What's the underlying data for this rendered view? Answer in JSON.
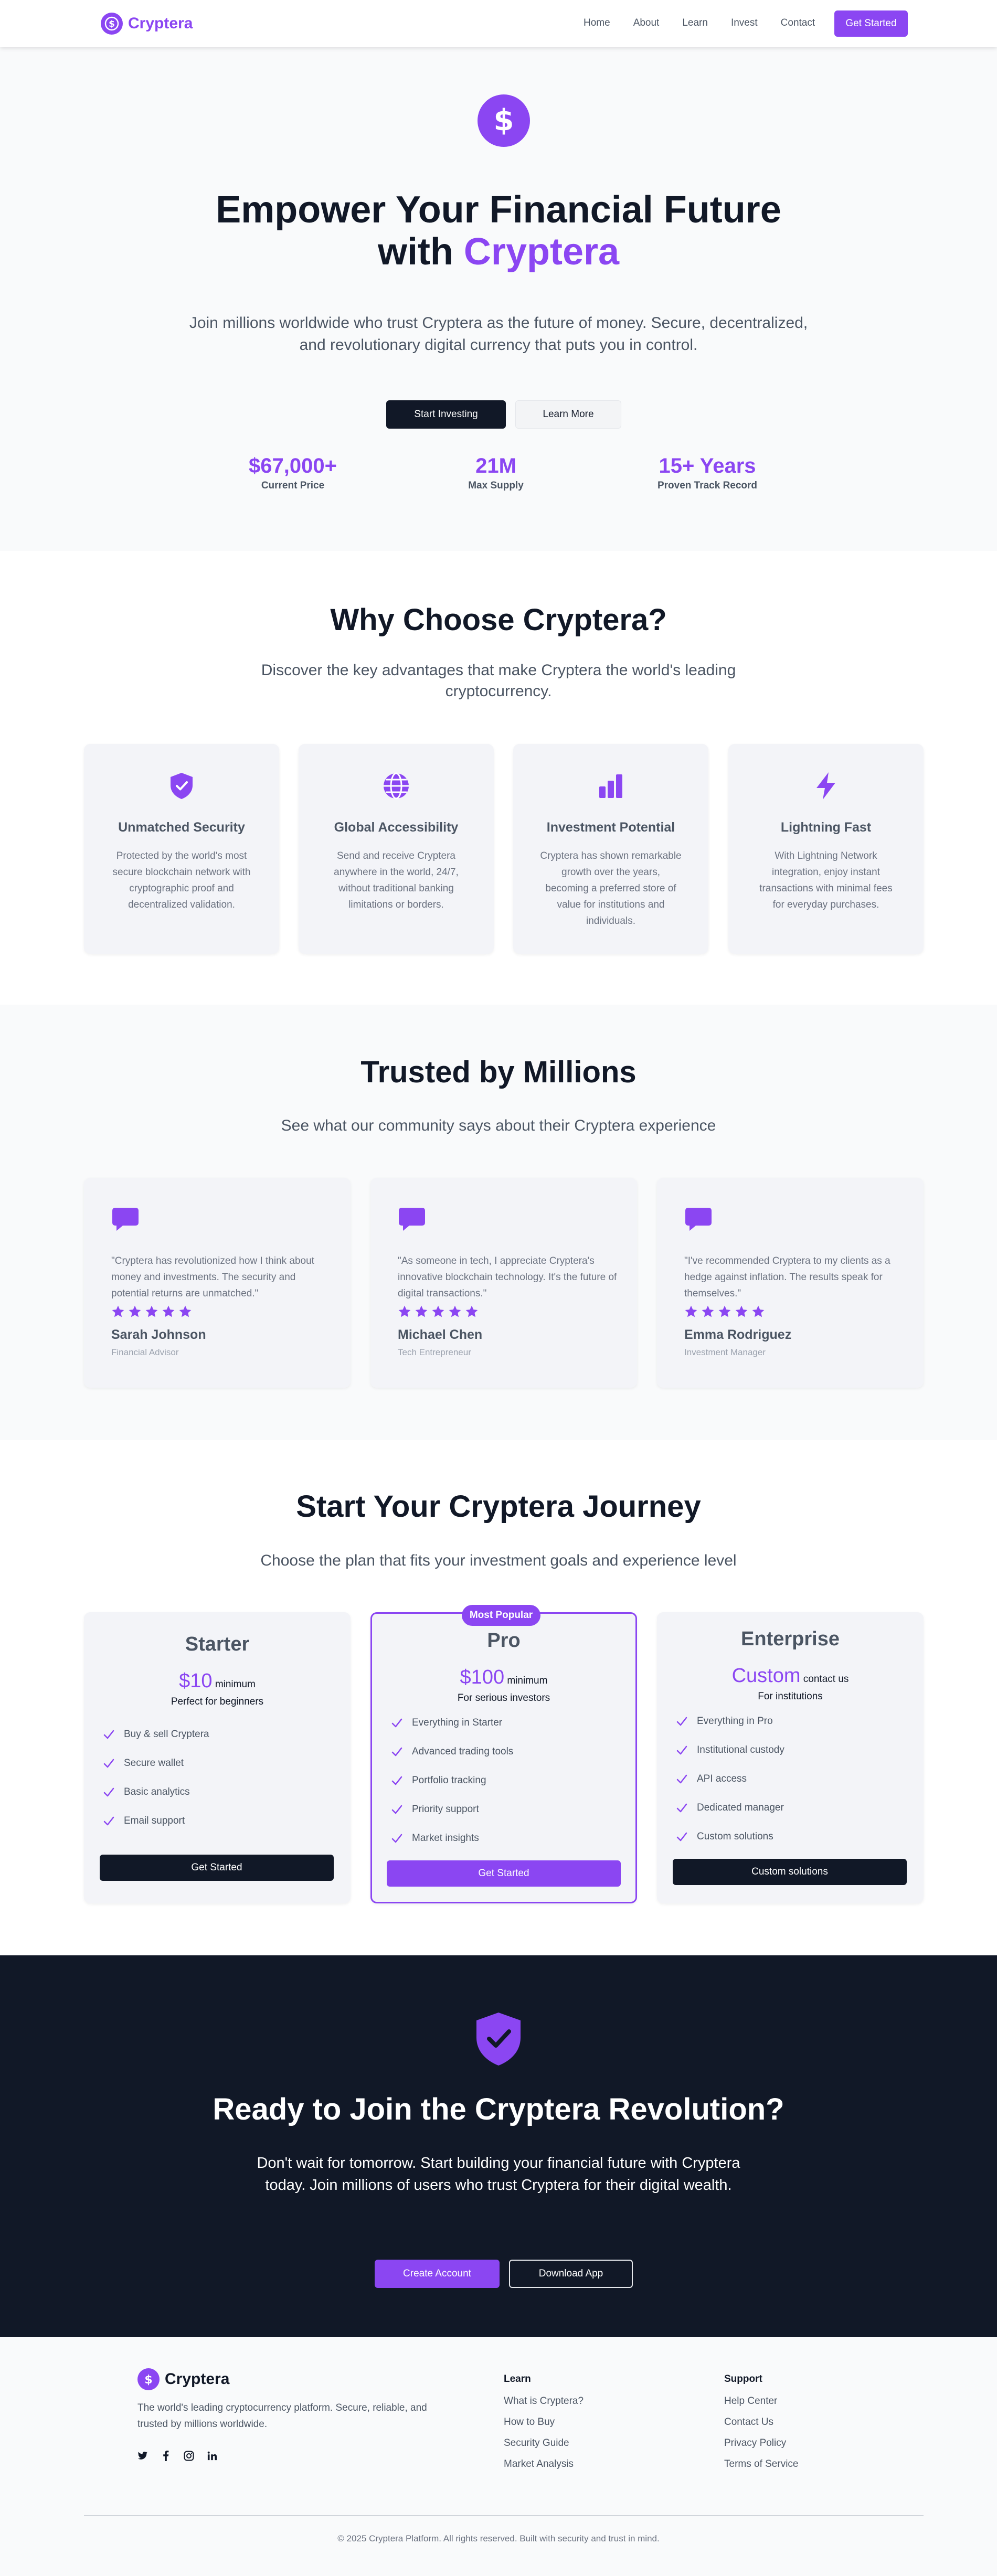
{
  "nav": {
    "brand": "Cryptera",
    "links": [
      "Home",
      "About",
      "Learn",
      "Invest",
      "Contact"
    ],
    "cta": "Get Started"
  },
  "hero": {
    "title_line1": "Empower Your Financial Future",
    "title_with": "with",
    "title_accent": "Cryptera",
    "subtitle": "Join millions worldwide who trust Cryptera as the future of money. Secure, decentralized, and revolutionary digital currency that puts you in control.",
    "primary_button": "Start Investing",
    "secondary_button": "Learn More",
    "stats": [
      {
        "value": "$67,000+",
        "label": "Current Price"
      },
      {
        "value": "21M",
        "label": "Max Supply"
      },
      {
        "value": "15+ Years",
        "label": "Proven Track Record"
      }
    ]
  },
  "features": {
    "title": "Why Choose Cryptera?",
    "subtitle": "Discover the key advantages that make Cryptera the world's leading cryptocurrency.",
    "items": [
      {
        "icon": "shield-check-icon",
        "title": "Unmatched Security",
        "desc": "Protected by the world's most secure blockchain network with cryptographic proof and decentralized validation."
      },
      {
        "icon": "globe-icon",
        "title": "Global Accessibility",
        "desc": "Send and receive Cryptera anywhere in the world, 24/7, without traditional banking limitations or borders."
      },
      {
        "icon": "bar-chart-icon",
        "title": "Investment Potential",
        "desc": "Cryptera has shown remarkable growth over the years, becoming a preferred store of value for institutions and individuals."
      },
      {
        "icon": "lightning-icon",
        "title": "Lightning Fast",
        "desc": "With Lightning Network integration, enjoy instant transactions with minimal fees for everyday purchases."
      }
    ]
  },
  "testimonials": {
    "title": "Trusted by Millions",
    "subtitle": "See what our community says about their Cryptera experience",
    "items": [
      {
        "text": "\"Cryptera has revolutionized how I think about money and investments. The security and potential returns are unmatched.\"",
        "name": "Sarah Johnson",
        "role": "Financial Advisor",
        "rating": 5
      },
      {
        "text": "\"As someone in tech, I appreciate Cryptera's innovative blockchain technology. It's the future of digital transactions.\"",
        "name": "Michael Chen",
        "role": "Tech Entrepreneur",
        "rating": 5
      },
      {
        "text": "\"I've recommended Cryptera to my clients as a hedge against inflation. The results speak for themselves.\"",
        "name": "Emma Rodriguez",
        "role": "Investment Manager",
        "rating": 5
      }
    ]
  },
  "pricing": {
    "title": "Start Your Cryptera Journey",
    "subtitle": "Choose the plan that fits your investment goals and experience level",
    "badge": "Most Popular",
    "plans": [
      {
        "name": "Starter",
        "price": "$10",
        "price_suffix": "minimum",
        "desc": "Perfect for beginners",
        "features": [
          "Buy & sell Cryptera",
          "Secure wallet",
          "Basic analytics",
          "Email support"
        ],
        "button": "Get Started"
      },
      {
        "name": "Pro",
        "price": "$100",
        "price_suffix": "minimum",
        "desc": "For serious investors",
        "features": [
          "Everything in Starter",
          "Advanced trading tools",
          "Portfolio tracking",
          "Priority support",
          "Market insights"
        ],
        "button": "Get Started"
      },
      {
        "name": "Enterprise",
        "price": "Custom",
        "price_suffix": "contact us",
        "desc": "For institutions",
        "features": [
          "Everything in Pro",
          "Institutional custody",
          "API access",
          "Dedicated manager",
          "Custom solutions"
        ],
        "button": "Custom solutions"
      }
    ]
  },
  "cta": {
    "title": "Ready to Join the Cryptera Revolution?",
    "subtitle": "Don't wait for tomorrow. Start building your financial future with Cryptera today. Join millions of users who trust Cryptera for their digital wealth.",
    "primary": "Create Account",
    "secondary": "Download App"
  },
  "footer": {
    "brand": "Cryptera",
    "desc": "The world's leading cryptocurrency platform. Secure, reliable, and trusted by millions worldwide.",
    "social": [
      "twitter-icon",
      "facebook-icon",
      "instagram-icon",
      "linkedin-icon"
    ],
    "learn_title": "Learn",
    "learn_links": [
      "What is Cryptera?",
      "How to Buy",
      "Security Guide",
      "Market Analysis"
    ],
    "support_title": "Support",
    "support_links": [
      "Help Center",
      "Contact Us",
      "Privacy Policy",
      "Terms of Service"
    ],
    "copyright": "© 2025 Cryptera Platform. All rights reserved. Built with security and trust in mind."
  },
  "colors": {
    "accent": "#8b46f2",
    "dark": "#111827",
    "muted": "#4b5563"
  }
}
